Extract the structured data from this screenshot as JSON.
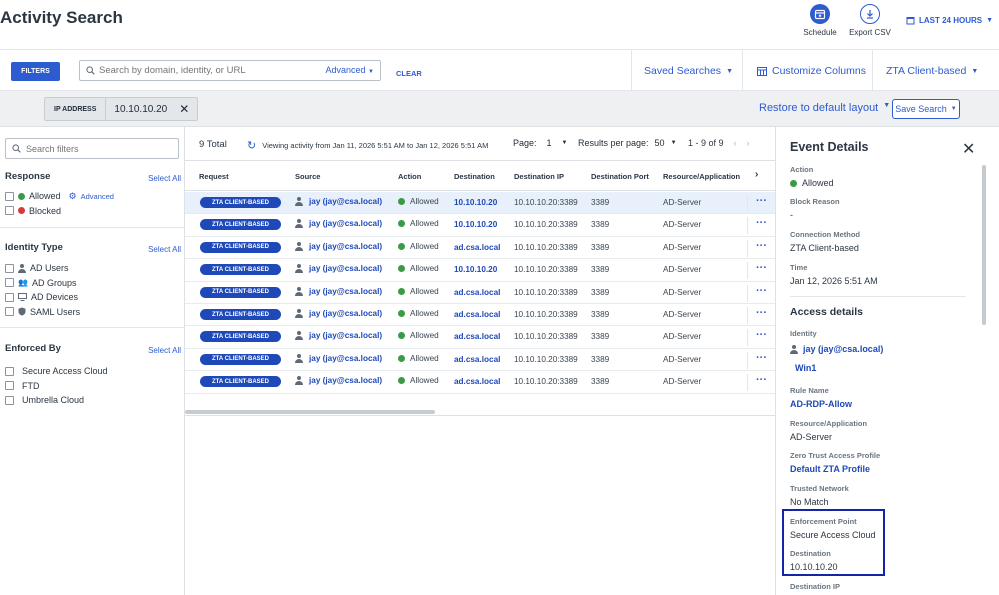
{
  "header": {
    "title": "Activity Search",
    "schedule_label": "Schedule",
    "export_label": "Export CSV",
    "time_range": "LAST 24 HOURS"
  },
  "toolbar": {
    "filters_label": "FILTERS",
    "search_placeholder": "Search by domain, identity, or URL",
    "advanced_label": "Advanced",
    "clear_label": "CLEAR",
    "saved_searches_label": "Saved Searches",
    "customize_columns_label": "Customize Columns",
    "view_selector_label": "ZTA Client-based"
  },
  "subbar": {
    "chip_key": "IP ADDRESS",
    "chip_value": "10.10.10.20",
    "restore_label": "Restore to default layout",
    "save_search_label": "Save Search"
  },
  "sidebar": {
    "search_placeholder": "Search filters",
    "select_all": "Select All",
    "response": {
      "title": "Response",
      "allowed": "Allowed",
      "advanced": "Advanced",
      "blocked": "Blocked"
    },
    "identity_type": {
      "title": "Identity Type",
      "items": [
        "AD Users",
        "AD Groups",
        "AD Devices",
        "SAML Users"
      ]
    },
    "enforced_by": {
      "title": "Enforced By",
      "items": [
        "Secure Access Cloud",
        "FTD",
        "Umbrella Cloud"
      ]
    }
  },
  "table": {
    "total": "9 Total",
    "viewing": "Viewing activity from Jan 11, 2026 5:51 AM to Jan 12, 2026 5:51 AM",
    "page_label": "Page:",
    "page_value": "1",
    "rpp_label": "Results per page:",
    "rpp_value": "50",
    "range": "1 - 9 of 9",
    "columns": [
      "Request",
      "Source",
      "Action",
      "Destination",
      "Destination IP",
      "Destination Port",
      "Resource/Application"
    ],
    "rows": [
      {
        "request": "ZTA CLIENT-BASED",
        "source": "jay (jay@csa.local)",
        "action": "Allowed",
        "destination": "10.10.10.20",
        "dest_ip": "10.10.10.20:3389",
        "port": "3389",
        "resource": "AD-Server"
      },
      {
        "request": "ZTA CLIENT-BASED",
        "source": "jay (jay@csa.local)",
        "action": "Allowed",
        "destination": "10.10.10.20",
        "dest_ip": "10.10.10.20:3389",
        "port": "3389",
        "resource": "AD-Server"
      },
      {
        "request": "ZTA CLIENT-BASED",
        "source": "jay (jay@csa.local)",
        "action": "Allowed",
        "destination": "ad.csa.local",
        "dest_ip": "10.10.10.20:3389",
        "port": "3389",
        "resource": "AD-Server"
      },
      {
        "request": "ZTA CLIENT-BASED",
        "source": "jay (jay@csa.local)",
        "action": "Allowed",
        "destination": "10.10.10.20",
        "dest_ip": "10.10.10.20:3389",
        "port": "3389",
        "resource": "AD-Server"
      },
      {
        "request": "ZTA CLIENT-BASED",
        "source": "jay (jay@csa.local)",
        "action": "Allowed",
        "destination": "ad.csa.local",
        "dest_ip": "10.10.10.20:3389",
        "port": "3389",
        "resource": "AD-Server"
      },
      {
        "request": "ZTA CLIENT-BASED",
        "source": "jay (jay@csa.local)",
        "action": "Allowed",
        "destination": "ad.csa.local",
        "dest_ip": "10.10.10.20:3389",
        "port": "3389",
        "resource": "AD-Server"
      },
      {
        "request": "ZTA CLIENT-BASED",
        "source": "jay (jay@csa.local)",
        "action": "Allowed",
        "destination": "ad.csa.local",
        "dest_ip": "10.10.10.20:3389",
        "port": "3389",
        "resource": "AD-Server"
      },
      {
        "request": "ZTA CLIENT-BASED",
        "source": "jay (jay@csa.local)",
        "action": "Allowed",
        "destination": "ad.csa.local",
        "dest_ip": "10.10.10.20:3389",
        "port": "3389",
        "resource": "AD-Server"
      },
      {
        "request": "ZTA CLIENT-BASED",
        "source": "jay (jay@csa.local)",
        "action": "Allowed",
        "destination": "ad.csa.local",
        "dest_ip": "10.10.10.20:3389",
        "port": "3389",
        "resource": "AD-Server"
      }
    ]
  },
  "details": {
    "title": "Event Details",
    "action_label": "Action",
    "action_value": "Allowed",
    "block_reason_label": "Block Reason",
    "block_reason_value": "-",
    "connection_method_label": "Connection Method",
    "connection_method_value": "ZTA Client-based",
    "time_label": "Time",
    "time_value": "Jan 12, 2026 5:51 AM",
    "access_details_title": "Access details",
    "identity_label": "Identity",
    "identity_value": "jay (jay@csa.local)",
    "identity_device": "Win1",
    "rule_name_label": "Rule Name",
    "rule_name_value": "AD-RDP-Allow",
    "resource_label": "Resource/Application",
    "resource_value": "AD-Server",
    "zta_profile_label": "Zero Trust Access Profile",
    "zta_profile_value": "Default ZTA Profile",
    "trusted_network_label": "Trusted Network",
    "trusted_network_value": "No Match",
    "enforcement_point_label": "Enforcement Point",
    "enforcement_point_value": "Secure Access Cloud",
    "destination_label": "Destination",
    "destination_value": "10.10.10.20",
    "destination_ip_label": "Destination IP"
  },
  "colors": {
    "accent": "#2d5bd0",
    "badge": "#1f49b8",
    "allowed": "#3a9a45",
    "blocked": "#d43c3c",
    "highlight_box": "#1424a8"
  }
}
